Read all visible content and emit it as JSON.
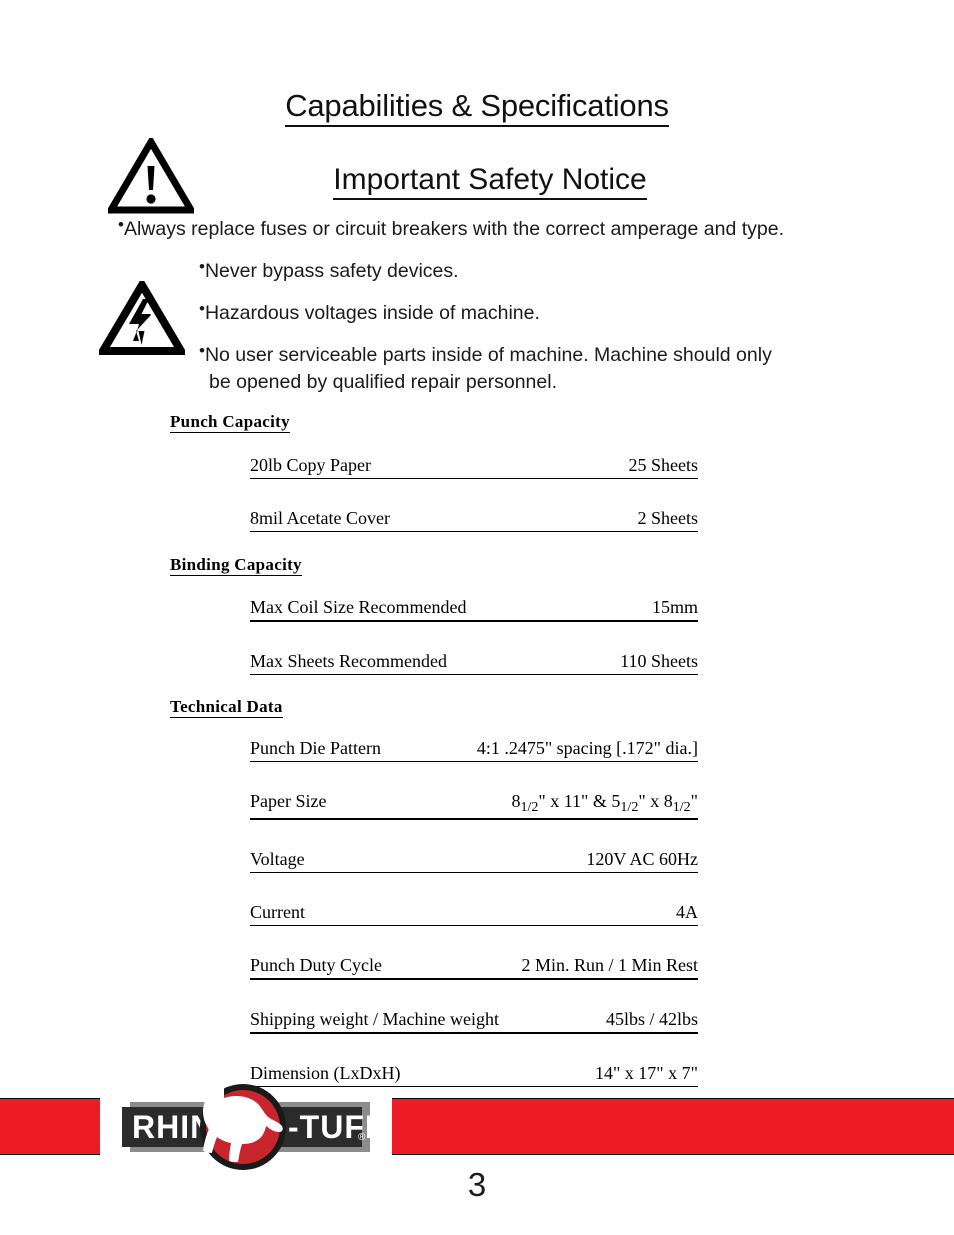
{
  "document": {
    "title": "Capabilities & Specifications",
    "safety_title": "Important Safety Notice",
    "page_number": "3"
  },
  "icons": {
    "warning": "warning-triangle-icon",
    "electric": "electrical-hazard-icon"
  },
  "safety_notice": {
    "bullets": [
      {
        "text": "Always replace fuses or circuit breakers with the correct amperage and type.",
        "continuation": ""
      },
      {
        "text": "Never bypass safety devices.",
        "continuation": ""
      },
      {
        "text": "Hazardous voltages inside of machine.",
        "continuation": ""
      },
      {
        "text": "No user serviceable parts inside of machine.  Machine should only",
        "continuation": "be opened by qualified repair personnel."
      }
    ]
  },
  "specs": {
    "punch_capacity": {
      "heading": "Punch Capacity",
      "rows": [
        {
          "label": "20lb Copy Paper",
          "value": "25 Sheets"
        },
        {
          "label": "8mil Acetate Cover",
          "value": "2 Sheets"
        }
      ]
    },
    "binding_capacity": {
      "heading": "Binding Capacity",
      "rows": [
        {
          "label": "Max Coil Size Recommended",
          "value": "15mm"
        },
        {
          "label": "Max Sheets Recommended",
          "value": "110 Sheets"
        }
      ]
    },
    "technical_data": {
      "heading": "Technical Data",
      "rows": [
        {
          "label": "Punch Die Pattern",
          "value": "4:1 .2475\" spacing [.172\" dia.]"
        },
        {
          "label": "Paper Size",
          "value": "8 1/2\" x 11\" & 5 1/2\" x 8 1/2\""
        },
        {
          "label": "Voltage",
          "value": "120V AC 60Hz"
        },
        {
          "label": "Current",
          "value": "4A"
        },
        {
          "label": "Punch Duty Cycle",
          "value": "2 Min. Run / 1 Min Rest"
        },
        {
          "label": "Shipping weight / Machine weight",
          "value": "45lbs / 42lbs"
        },
        {
          "label": "Dimension (LxDxH)",
          "value": "14\" x 17\" x 7\""
        }
      ]
    }
  },
  "footer": {
    "logo": {
      "text_left": "RHIN-",
      "text_right": "-TUFF",
      "registered_mark": "®",
      "alt": "rhino-head-logo"
    },
    "colors": {
      "red": "#ED1C24",
      "logo_red": "#C8252C",
      "logo_dark": "#2B2B2B",
      "logo_gray": "#8C8C8C"
    }
  }
}
